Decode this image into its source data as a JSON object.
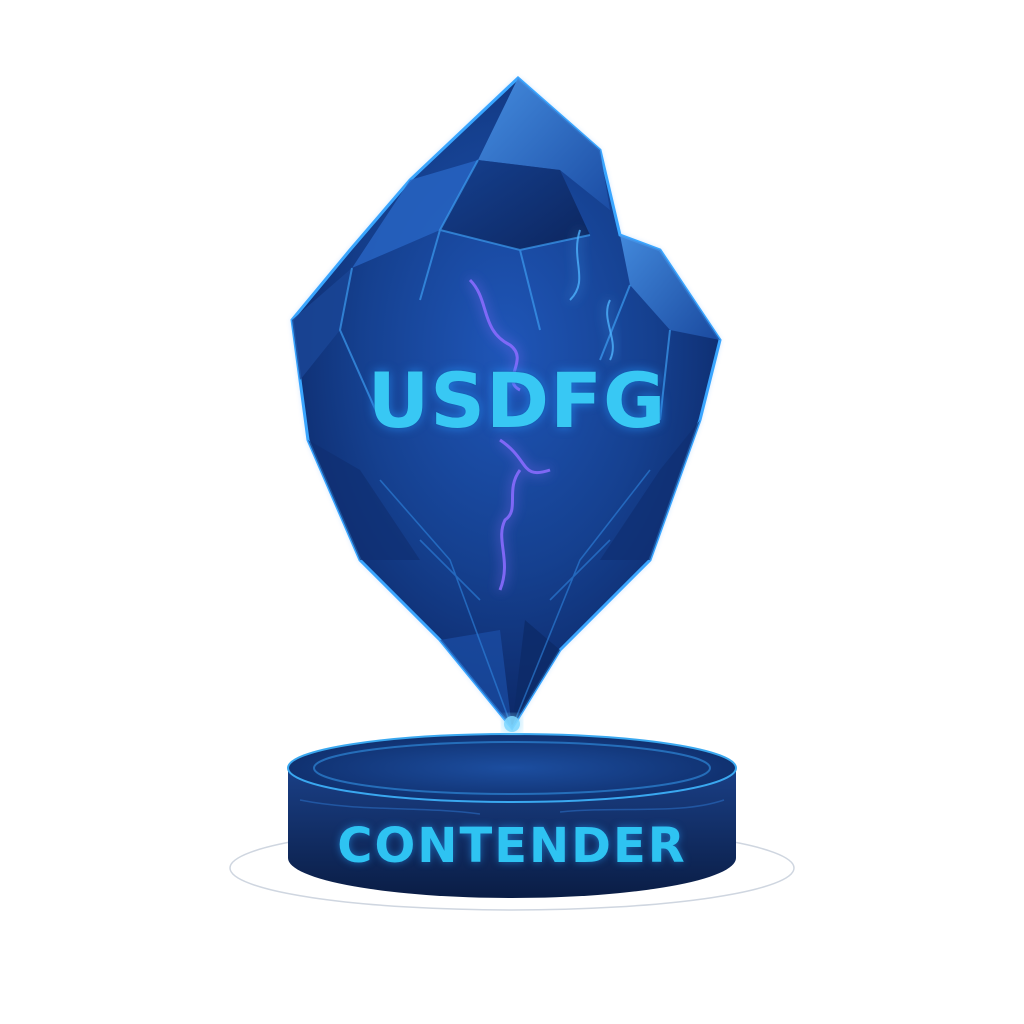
{
  "emblem": {
    "crystal_text": "USDFG",
    "pedestal_text": "CONTENDER"
  },
  "colors": {
    "crystal_dark": "#0d2a6b",
    "crystal_mid": "#1f56b8",
    "crystal_light": "#3b86e0",
    "glow": "#2fb8ff",
    "vein": "#8a6cff",
    "text_cyan": "#38c8f4",
    "pedestal_dark": "#0c2350",
    "background": "#ffffff"
  }
}
